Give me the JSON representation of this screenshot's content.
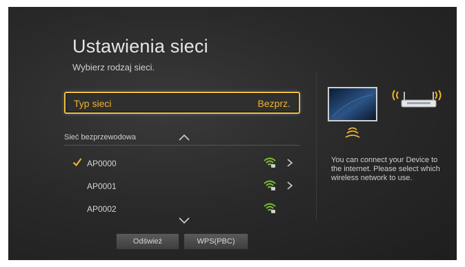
{
  "header": {
    "title": "Ustawienia sieci",
    "subtitle": "Wybierz rodzaj sieci."
  },
  "network_type": {
    "label": "Typ sieci",
    "value": "Bezprz."
  },
  "wireless_list": {
    "header": "Sieć bezprzewodowa",
    "networks": [
      {
        "ssid": "AP0000",
        "selected": true,
        "has_details": true,
        "icon": "wifi-signal-icon"
      },
      {
        "ssid": "AP0001",
        "selected": false,
        "has_details": true,
        "icon": "wifi-signal-icon"
      },
      {
        "ssid": "AP0002",
        "selected": false,
        "has_details": false,
        "icon": "wifi-signal-icon"
      }
    ]
  },
  "buttons": {
    "refresh": "Odśwież",
    "wps": "WPS(PBC)"
  },
  "help": {
    "text": "You can connect your Device to the internet. Please select which wireless network to use."
  },
  "colors": {
    "accent": "#f0b430",
    "wifi_green": "#7cc035",
    "background": "#2a2a2a"
  }
}
